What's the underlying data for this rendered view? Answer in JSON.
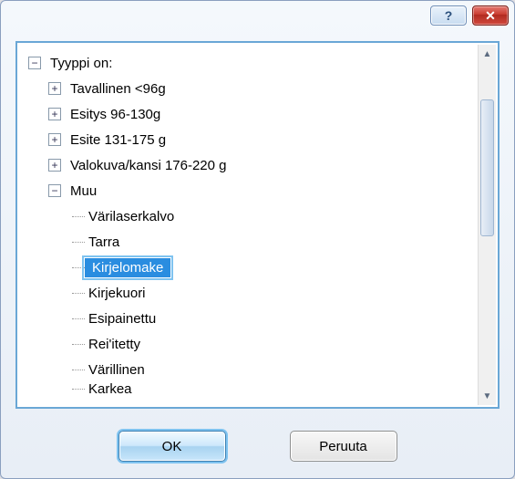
{
  "titlebar": {
    "help": "?",
    "close": "✕"
  },
  "tree": {
    "root_label": "Tyyppi on:",
    "items": [
      {
        "label": "Tavallinen <96g",
        "expandable": true
      },
      {
        "label": "Esitys 96-130g",
        "expandable": true
      },
      {
        "label": "Esite 131-175 g",
        "expandable": true
      },
      {
        "label": "Valokuva/kansi 176-220 g",
        "expandable": true
      },
      {
        "label": "Muu",
        "expandable": true,
        "expanded": true
      }
    ],
    "muu_children": [
      "Värilaserkalvo",
      "Tarra",
      "Kirjelomake",
      "Kirjekuori",
      "Esipainettu",
      "Rei'itetty",
      "Värillinen",
      "Karkea"
    ],
    "selected": "Kirjelomake"
  },
  "buttons": {
    "ok": "OK",
    "cancel": "Peruuta"
  }
}
